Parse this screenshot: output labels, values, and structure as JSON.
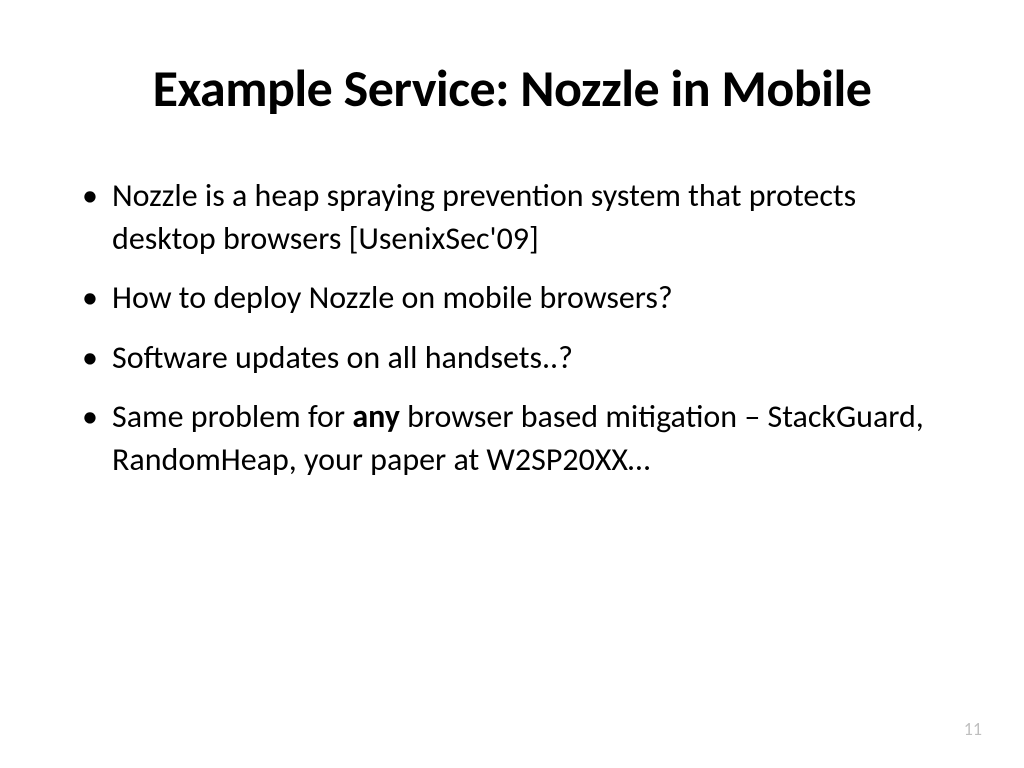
{
  "slide": {
    "title": "Example Service: Nozzle in Mobile",
    "bullets": [
      {
        "text": "Nozzle is a heap spraying prevention system that protects desktop browsers [UsenixSec'09]"
      },
      {
        "text": "How to deploy Nozzle on mobile browsers?"
      },
      {
        "text": "Software updates on all handsets..?"
      },
      {
        "prefix": "Same problem for ",
        "bold": "any",
        "suffix": " browser based mitigation – StackGuard, RandomHeap, your paper at W2SP20XX…"
      }
    ],
    "page_number": "11"
  }
}
